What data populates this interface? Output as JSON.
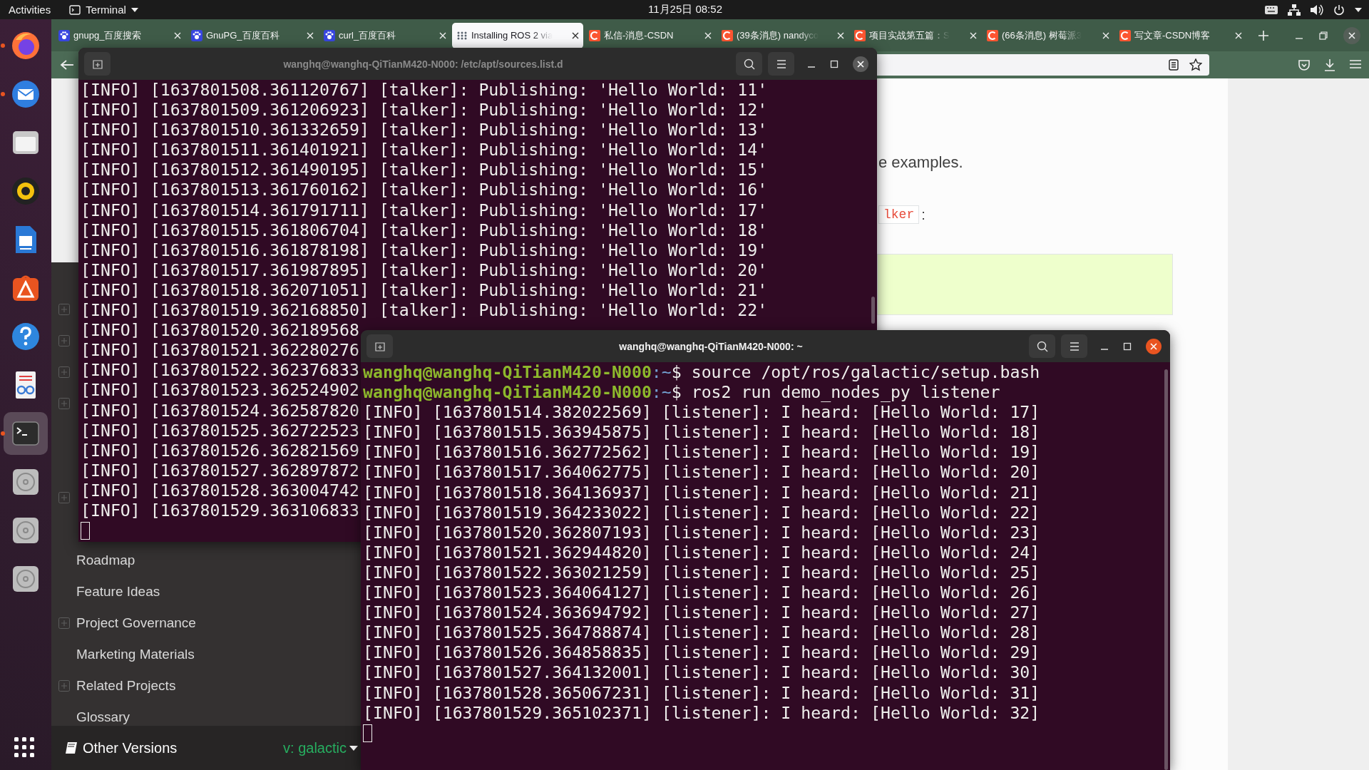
{
  "top_bar": {
    "activities": "Activities",
    "app_menu": "Terminal",
    "clock": "11月25日  08:52"
  },
  "dock": {
    "items": [
      {
        "kind": "browser",
        "running": true,
        "selected": false
      },
      {
        "kind": "mail",
        "running": true,
        "selected": false
      },
      {
        "kind": "files",
        "running": false,
        "selected": false
      },
      {
        "kind": "music",
        "running": false,
        "selected": false
      },
      {
        "kind": "writer",
        "running": false,
        "selected": false
      },
      {
        "kind": "store",
        "running": false,
        "selected": false
      },
      {
        "kind": "help",
        "running": false,
        "selected": false
      },
      {
        "kind": "viewer",
        "running": false,
        "selected": false
      },
      {
        "kind": "terminal",
        "running": true,
        "selected": true
      },
      {
        "kind": "disc",
        "running": false,
        "selected": false
      },
      {
        "kind": "disc",
        "running": false,
        "selected": false
      },
      {
        "kind": "disc",
        "running": false,
        "selected": false
      }
    ]
  },
  "browser": {
    "tabs": [
      {
        "label": "gnupg_百度搜索",
        "selected": false,
        "faded": false
      },
      {
        "label": "GnuPG_百度百科",
        "selected": false,
        "faded": false
      },
      {
        "label": "curl_百度百科",
        "selected": false,
        "faded": false
      },
      {
        "label": "Installing ROS 2 via",
        "selected": true,
        "faded": true
      },
      {
        "label": "私信-消息-CSDN",
        "selected": false,
        "faded": false
      },
      {
        "label": "(39条消息) nandyco",
        "selected": false,
        "faded": true
      },
      {
        "label": "项目实战第五篇：S",
        "selected": false,
        "faded": true
      },
      {
        "label": "(66条消息) 树莓派3",
        "selected": false,
        "faded": true
      },
      {
        "label": "写文章-CSDN博客",
        "selected": false,
        "faded": false
      }
    ],
    "sidebar": {
      "rows": [
        {
          "expandable": false
        },
        {
          "expandable": true
        },
        {
          "expandable": true
        },
        {
          "expandable": true
        },
        {
          "expandable": true
        },
        {
          "expandable": false
        },
        {
          "expandable": false
        },
        {
          "expandable": true
        },
        {
          "expandable": false
        },
        {
          "label": "Roadmap",
          "expandable": false
        },
        {
          "label": "Feature Ideas",
          "expandable": false
        },
        {
          "label": "Project Governance",
          "expandable": true
        },
        {
          "label": "Marketing Materials",
          "expandable": false
        },
        {
          "label": "Related Projects",
          "expandable": true
        },
        {
          "label": "Glossary",
          "expandable": false
        }
      ],
      "footer": {
        "label": "Other Versions",
        "version": "v: galactic"
      }
    },
    "page": {
      "paragraph": "e examples.",
      "code": "lker",
      "after_code": ":"
    }
  },
  "terminals": [
    {
      "title": "wanghq@wanghq-QiTianM420-N000: /etc/apt/sources.list.d",
      "active": false,
      "cursor": true,
      "lines": [
        {
          "kind": "output",
          "text": "[INFO] [1637801508.361120767] [talker]: Publishing: 'Hello World: 11'"
        },
        {
          "kind": "output",
          "text": "[INFO] [1637801509.361206923] [talker]: Publishing: 'Hello World: 12'"
        },
        {
          "kind": "output",
          "text": "[INFO] [1637801510.361332659] [talker]: Publishing: 'Hello World: 13'"
        },
        {
          "kind": "output",
          "text": "[INFO] [1637801511.361401921] [talker]: Publishing: 'Hello World: 14'"
        },
        {
          "kind": "output",
          "text": "[INFO] [1637801512.361490195] [talker]: Publishing: 'Hello World: 15'"
        },
        {
          "kind": "output",
          "text": "[INFO] [1637801513.361760162] [talker]: Publishing: 'Hello World: 16'"
        },
        {
          "kind": "output",
          "text": "[INFO] [1637801514.361791711] [talker]: Publishing: 'Hello World: 17'"
        },
        {
          "kind": "output",
          "text": "[INFO] [1637801515.361806704] [talker]: Publishing: 'Hello World: 18'"
        },
        {
          "kind": "output",
          "text": "[INFO] [1637801516.361878198] [talker]: Publishing: 'Hello World: 19'"
        },
        {
          "kind": "output",
          "text": "[INFO] [1637801517.361987895] [talker]: Publishing: 'Hello World: 20'"
        },
        {
          "kind": "output",
          "text": "[INFO] [1637801518.362071051] [talker]: Publishing: 'Hello World: 21'"
        },
        {
          "kind": "output",
          "text": "[INFO] [1637801519.362168850] [talker]: Publishing: 'Hello World: 22'"
        },
        {
          "kind": "output",
          "text": "[INFO] [1637801520.362189568"
        },
        {
          "kind": "output",
          "text": "[INFO] [1637801521.362280276"
        },
        {
          "kind": "output",
          "text": "[INFO] [1637801522.362376833"
        },
        {
          "kind": "output",
          "text": "[INFO] [1637801523.362524902"
        },
        {
          "kind": "output",
          "text": "[INFO] [1637801524.362587820"
        },
        {
          "kind": "output",
          "text": "[INFO] [1637801525.362722523"
        },
        {
          "kind": "output",
          "text": "[INFO] [1637801526.362821569"
        },
        {
          "kind": "output",
          "text": "[INFO] [1637801527.362897872"
        },
        {
          "kind": "output",
          "text": "[INFO] [1637801528.363004742"
        },
        {
          "kind": "output",
          "text": "[INFO] [1637801529.363106833"
        }
      ]
    },
    {
      "title": "wanghq@wanghq-QiTianM420-N000: ~",
      "active": true,
      "cursor": true,
      "lines": [
        {
          "kind": "prompt",
          "user_host": "wanghq@wanghq-QiTianM420-N000",
          "path": ":~",
          "command": "$ source /opt/ros/galactic/setup.bash"
        },
        {
          "kind": "prompt",
          "user_host": "wanghq@wanghq-QiTianM420-N000",
          "path": ":~",
          "command": "$ ros2 run demo_nodes_py listener"
        },
        {
          "kind": "output",
          "text": "[INFO] [1637801514.382022569] [listener]: I heard: [Hello World: 17]"
        },
        {
          "kind": "output",
          "text": "[INFO] [1637801515.363945875] [listener]: I heard: [Hello World: 18]"
        },
        {
          "kind": "output",
          "text": "[INFO] [1637801516.362772562] [listener]: I heard: [Hello World: 19]"
        },
        {
          "kind": "output",
          "text": "[INFO] [1637801517.364062775] [listener]: I heard: [Hello World: 20]"
        },
        {
          "kind": "output",
          "text": "[INFO] [1637801518.364136937] [listener]: I heard: [Hello World: 21]"
        },
        {
          "kind": "output",
          "text": "[INFO] [1637801519.364233022] [listener]: I heard: [Hello World: 22]"
        },
        {
          "kind": "output",
          "text": "[INFO] [1637801520.362807193] [listener]: I heard: [Hello World: 23]"
        },
        {
          "kind": "output",
          "text": "[INFO] [1637801521.362944820] [listener]: I heard: [Hello World: 24]"
        },
        {
          "kind": "output",
          "text": "[INFO] [1637801522.363021259] [listener]: I heard: [Hello World: 25]"
        },
        {
          "kind": "output",
          "text": "[INFO] [1637801523.364064127] [listener]: I heard: [Hello World: 26]"
        },
        {
          "kind": "output",
          "text": "[INFO] [1637801524.363694792] [listener]: I heard: [Hello World: 27]"
        },
        {
          "kind": "output",
          "text": "[INFO] [1637801525.364788874] [listener]: I heard: [Hello World: 28]"
        },
        {
          "kind": "output",
          "text": "[INFO] [1637801526.364858835] [listener]: I heard: [Hello World: 29]"
        },
        {
          "kind": "output",
          "text": "[INFO] [1637801527.364132001] [listener]: I heard: [Hello World: 30]"
        },
        {
          "kind": "output",
          "text": "[INFO] [1637801528.365067231] [listener]: I heard: [Hello World: 31]"
        },
        {
          "kind": "output",
          "text": "[INFO] [1637801529.365102371] [listener]: I heard: [Hello World: 32]"
        }
      ]
    }
  ]
}
